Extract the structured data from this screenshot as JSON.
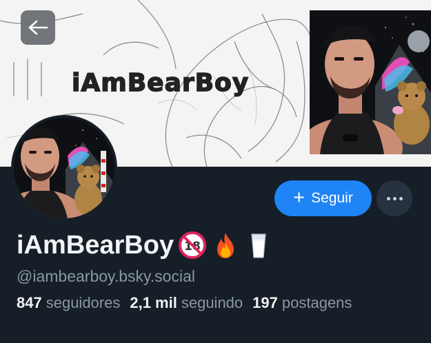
{
  "banner": {
    "title": "iAmBearBoy"
  },
  "header": {
    "back_icon": "arrow-left-icon"
  },
  "actions": {
    "follow_label": "Seguir",
    "follow_icon": "plus-icon",
    "more_icon": "ellipsis-icon"
  },
  "profile": {
    "display_name": "iAmBearBoy",
    "emojis": [
      "no-under-18-icon",
      "fire-icon",
      "glass-of-milk-icon"
    ],
    "handle": "@iambearboy.bsky.social"
  },
  "stats": [
    {
      "count": "847",
      "label": "seguidores"
    },
    {
      "count": "2,1 mil",
      "label": "seguindo"
    },
    {
      "count": "197",
      "label": "postagens"
    }
  ],
  "colors": {
    "background": "#161e27",
    "accent": "#1f84f5",
    "secondary_text": "#8a97a8"
  }
}
